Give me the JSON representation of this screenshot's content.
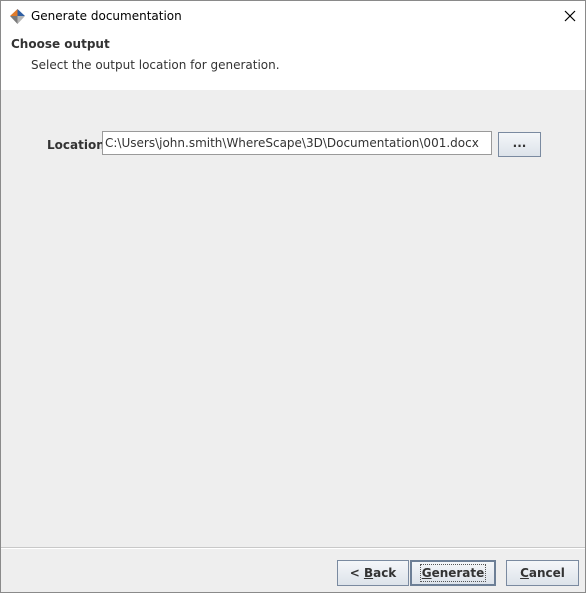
{
  "window": {
    "title": "Generate documentation"
  },
  "header": {
    "title": "Choose output",
    "subtitle": "Select the output location for generation."
  },
  "location": {
    "label": "Location:",
    "value": "C:\\Users\\john.smith\\WhereScape\\3D\\Documentation\\001.docx",
    "browse_label": "..."
  },
  "footer": {
    "back_prefix": "< ",
    "back_mnemonic": "B",
    "back_rest": "ack",
    "generate_mnemonic": "G",
    "generate_rest": "enerate",
    "cancel_mnemonic": "C",
    "cancel_rest": "ancel"
  },
  "icons": {
    "app": "wherescape-app-icon",
    "close": "close-icon"
  }
}
